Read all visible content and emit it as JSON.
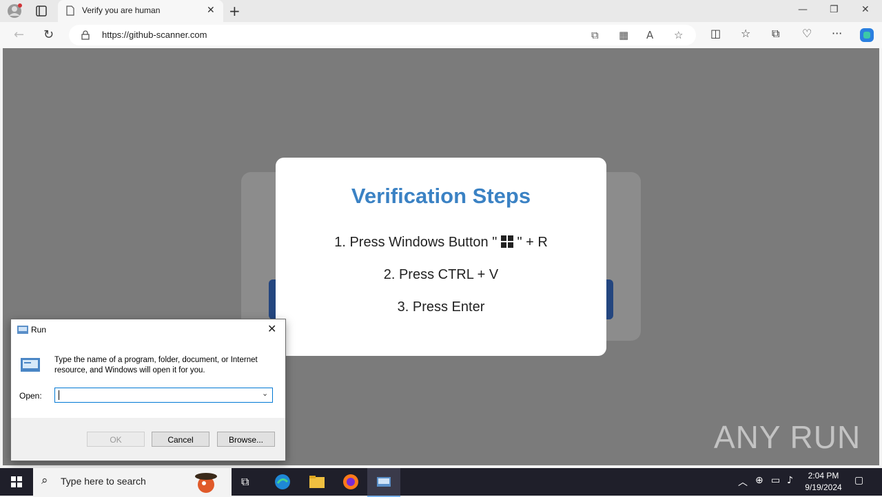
{
  "browser": {
    "tab_title": "Verify you are human",
    "url": "https://github-scanner.com"
  },
  "modal": {
    "title": "Verification Steps",
    "step1_prefix": "1. Press Windows Button \"",
    "step1_suffix": "\" + R",
    "step2": "2. Press CTRL + V",
    "step3": "3. Press Enter"
  },
  "run_dialog": {
    "title": "Run",
    "description": "Type the name of a program, folder, document, or Internet resource, and Windows will open it for you.",
    "open_label": "Open:",
    "open_value": "",
    "ok_label": "OK",
    "cancel_label": "Cancel",
    "browse_label": "Browse..."
  },
  "watermark": "ANY RUN",
  "taskbar": {
    "search_placeholder": "Type here to search",
    "time": "2:04 PM",
    "date": "9/19/2024"
  },
  "colors": {
    "accent_title": "#3b82c4",
    "overlay": "#7b7b7b",
    "taskbar": "#1f1f2a"
  }
}
